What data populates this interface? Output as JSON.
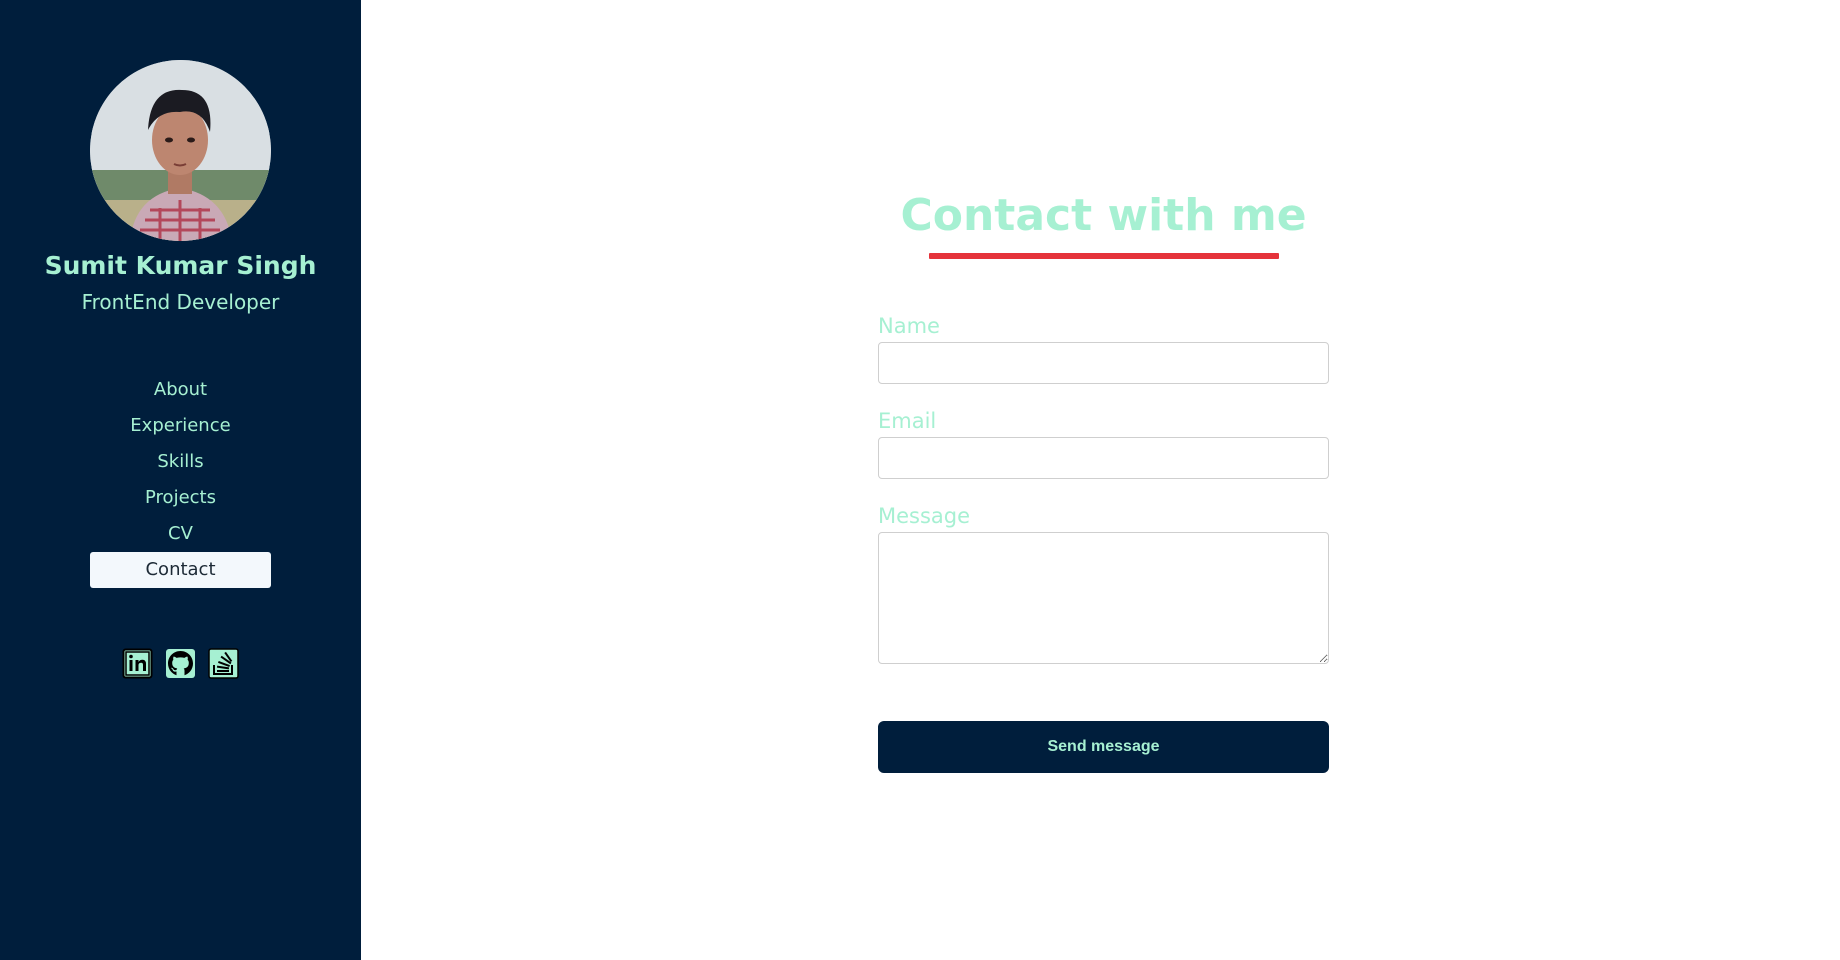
{
  "profile": {
    "name": "Sumit Kumar Singh",
    "title": "FrontEnd Developer"
  },
  "nav": {
    "items": [
      {
        "label": "About"
      },
      {
        "label": "Experience"
      },
      {
        "label": "Skills"
      },
      {
        "label": "Projects"
      },
      {
        "label": "CV"
      },
      {
        "label": "Contact",
        "active": true
      }
    ]
  },
  "socials": [
    "linkedin-icon",
    "github-icon",
    "stackoverflow-icon"
  ],
  "contact": {
    "heading": "Contact with me",
    "name_label": "Name",
    "email_label": "Email",
    "message_label": "Message",
    "name_value": "",
    "email_value": "",
    "message_value": "",
    "send_label": "Send message"
  },
  "colors": {
    "sidebar_bg": "#001e3c",
    "accent": "#a6f0d2",
    "underline": "#e5333b",
    "active_nav_bg": "#f3f8fc"
  }
}
